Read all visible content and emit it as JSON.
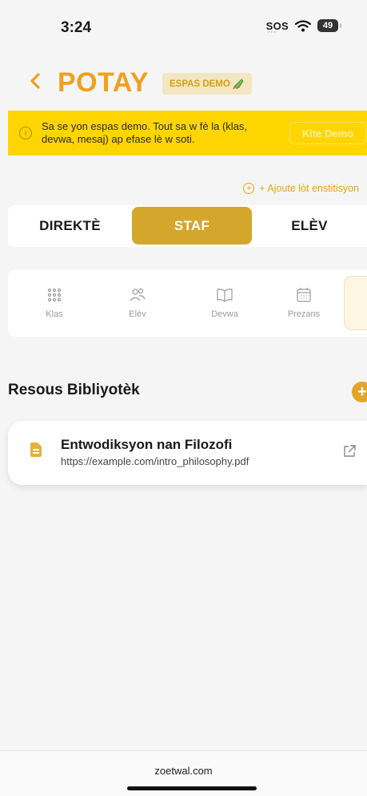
{
  "status_bar": {
    "time": "3:24",
    "sos": "SOS",
    "wifi_icon": "wifi-icon",
    "battery": "49"
  },
  "header": {
    "back_icon": "chevron-left-icon",
    "title": "POTAY",
    "badge": "ESPAS DEMO",
    "badge_icon": "test-tube-icon"
  },
  "banner": {
    "icon": "info-icon",
    "text": "Sa se yon espas demo. Tout sa w fè la (klas, devwa, mesaj) ap efase lè w soti.",
    "button": "Kite Demo"
  },
  "add_institution": "+ Ajoute lòt enstitisyon",
  "tabs": [
    {
      "label": "DIREKTÈ",
      "active": false
    },
    {
      "label": "STAF",
      "active": true
    },
    {
      "label": "ELÈV",
      "active": false
    }
  ],
  "nav": [
    {
      "label": "Klas",
      "icon": "grid-icon"
    },
    {
      "label": "Elèv",
      "icon": "users-icon"
    },
    {
      "label": "Devwa",
      "icon": "book-icon"
    },
    {
      "label": "Prezans",
      "icon": "calendar-icon"
    }
  ],
  "section": {
    "title": "Resous Bibliyotèk",
    "add_icon": "plus-icon"
  },
  "resources": [
    {
      "title": "Entwodiksyon nan Filozofi",
      "url": "https://example.com/intro_philosophy.pdf",
      "icon": "document-icon",
      "action_icon": "external-link-icon"
    }
  ],
  "footer": {
    "url": "zoetwal.com"
  },
  "colors": {
    "accent": "#f0a020",
    "tab_active": "#d4a72c",
    "banner": "#ffd500"
  }
}
